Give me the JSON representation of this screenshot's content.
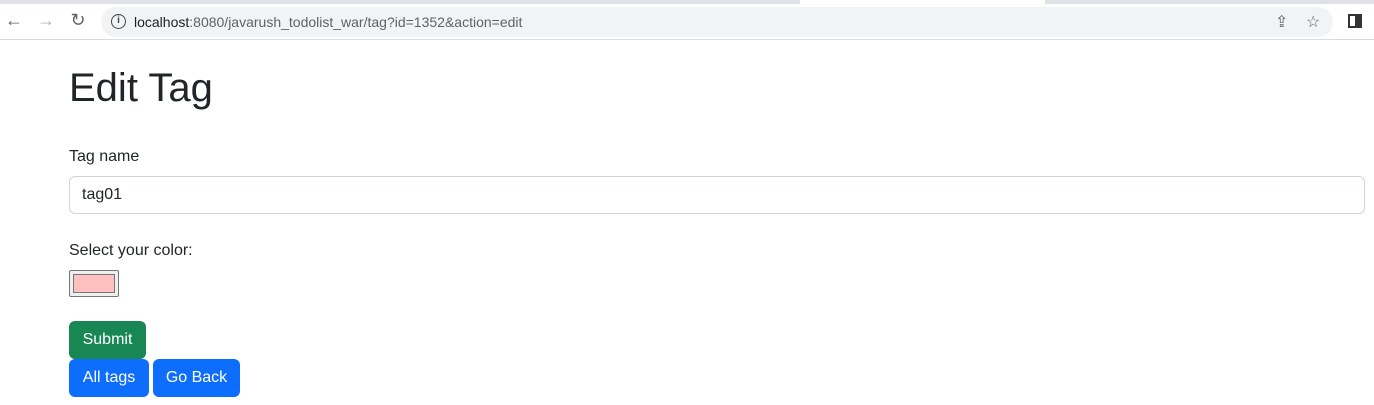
{
  "browser": {
    "url_host": "localhost",
    "url_rest": ":8080/javarush_todolist_war/tag?id=1352&action=edit"
  },
  "page": {
    "title": "Edit Tag",
    "tag_name_label": "Tag name",
    "tag_name_value": "tag01",
    "color_label": "Select your color:",
    "color_value": "#ffc0c0",
    "submit": "Submit",
    "all_tags": "All tags",
    "go_back": "Go Back"
  },
  "colors": {
    "submit": "#198754",
    "primary": "#0d6efd"
  }
}
